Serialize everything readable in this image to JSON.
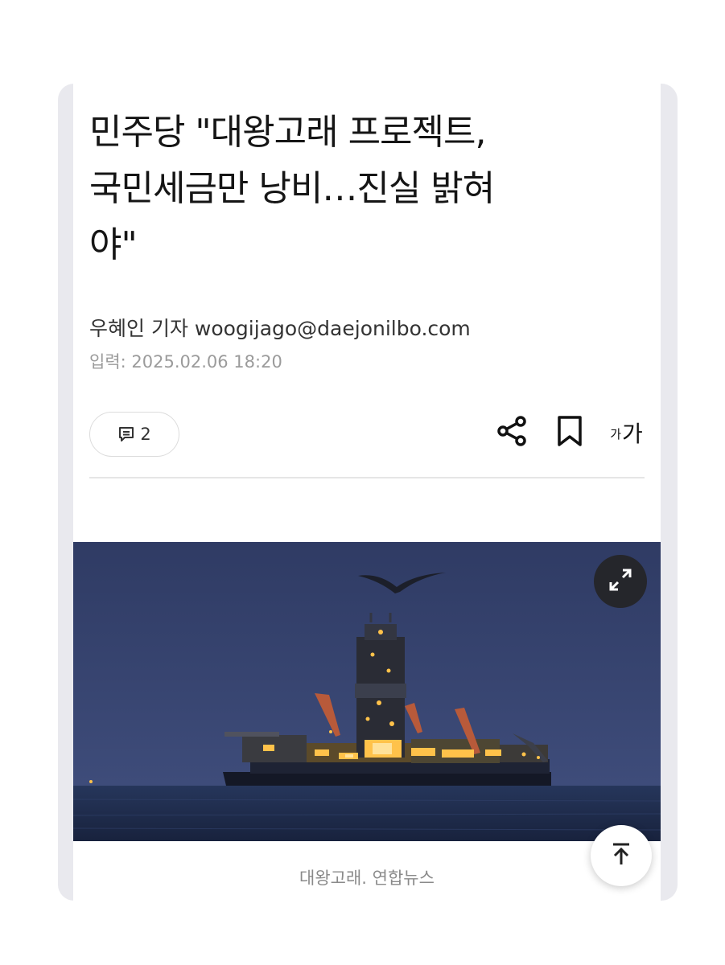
{
  "article": {
    "title_lines": [
      "민주당 \"대왕고래 프로젝트,",
      "국민세금만 낭비…진실 밝혀",
      "야\""
    ],
    "byline": "우혜인 기자 woogijago@daejonilbo.com",
    "dateline": "입력: 2025.02.06 18:20"
  },
  "toolbar": {
    "comment_count": "2",
    "font_size_small": "가",
    "font_size_large": "가"
  },
  "photo": {
    "caption": "대왕고래. 연합뉴스"
  },
  "icons": {
    "comment": "comment-icon",
    "share": "share-icon",
    "bookmark": "bookmark-icon",
    "expand": "expand-icon",
    "scroll_top": "arrow-up-to-top-icon"
  },
  "colors": {
    "frame": "#e9e9ee",
    "text": "#151515",
    "meta": "#9b9b9b",
    "sky": "#3b4a78",
    "sea": "#1f2d4e",
    "lights": "#ffc24a"
  }
}
